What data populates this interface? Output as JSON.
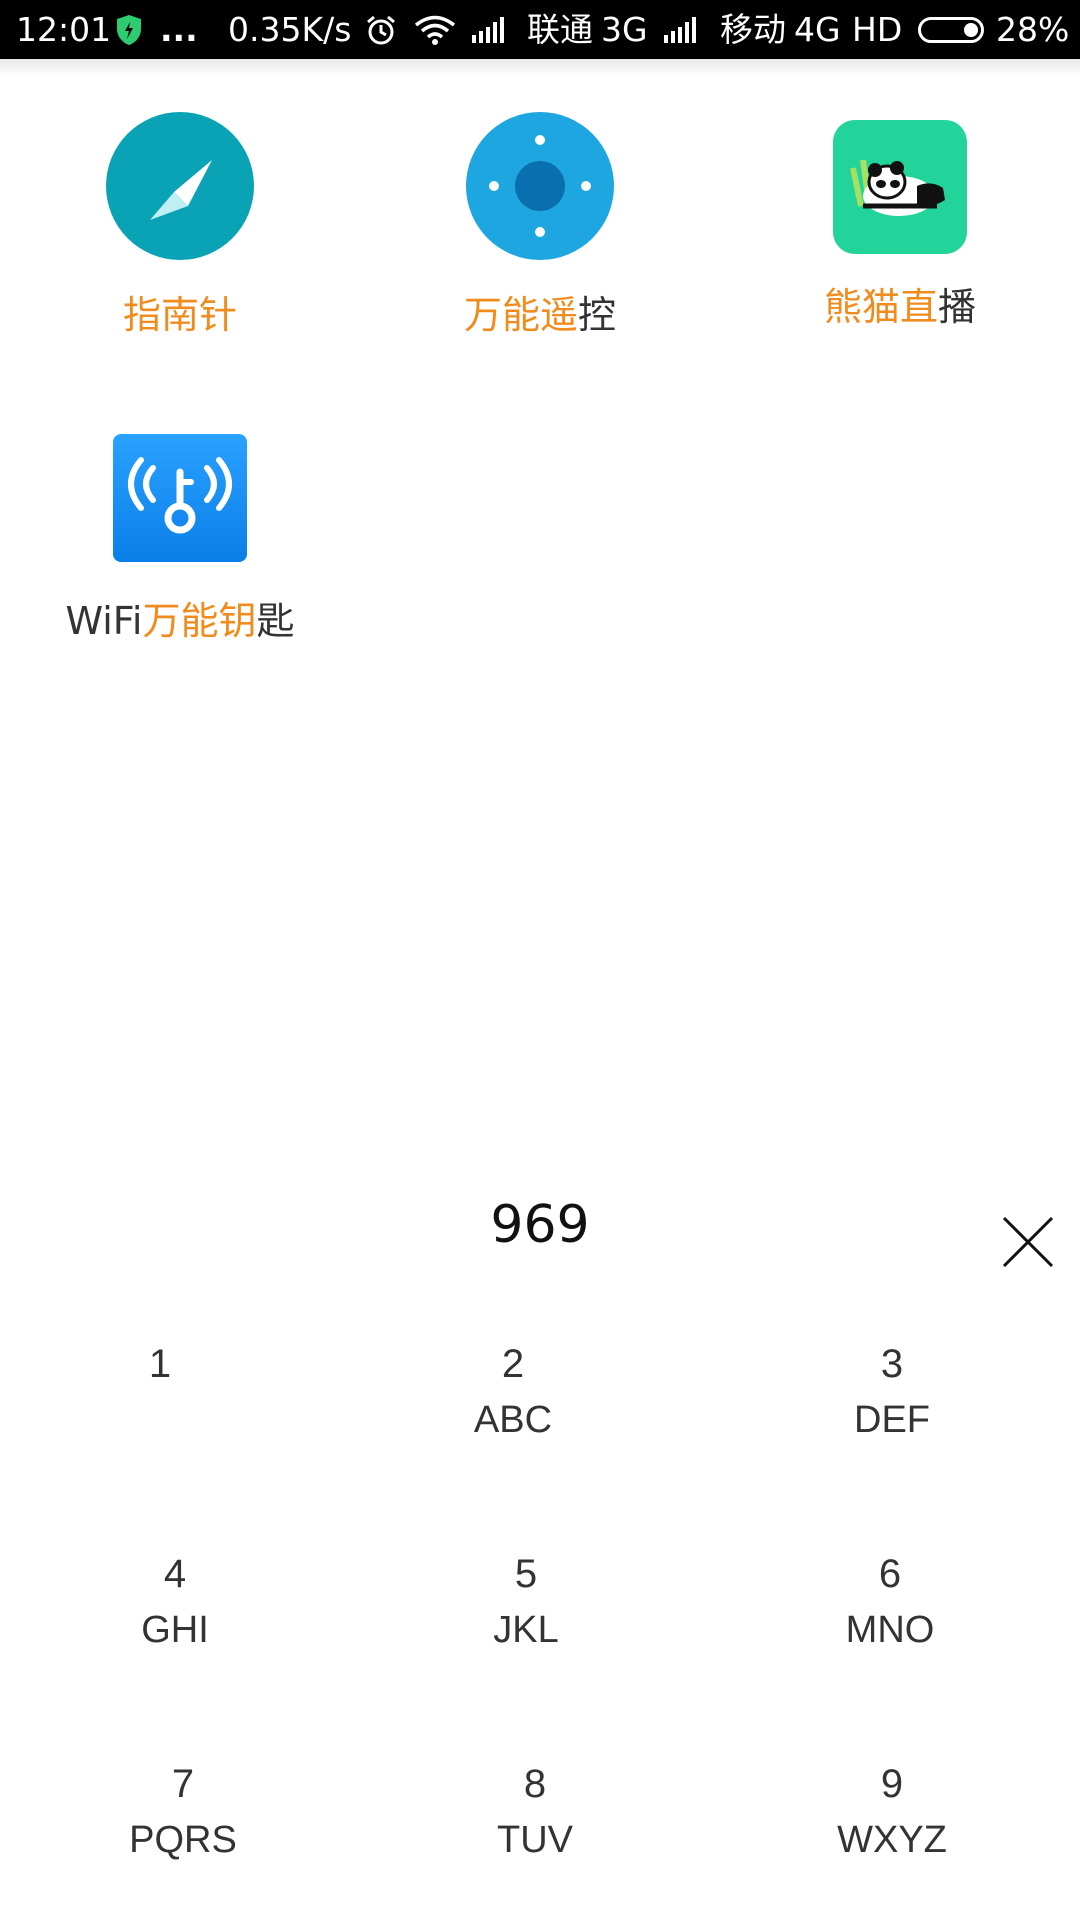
{
  "status_bar": {
    "time": "12:01",
    "more": "...",
    "net_speed": "0.35K/s",
    "carrier1": "联通",
    "carrier1_net": "3G",
    "carrier2": "移动",
    "carrier2_net": "4G",
    "hd": "HD",
    "battery": "28%",
    "battery_level": 0.28,
    "shield_color": "#2ecc71"
  },
  "apps": [
    {
      "icon": "compass-icon",
      "label_hl": "指南针",
      "label_rest": "",
      "color": "#0aa3b5"
    },
    {
      "icon": "remote-icon",
      "label_hl": "万能遥",
      "label_rest": "控",
      "color": "#1ea6e0"
    },
    {
      "icon": "panda-icon",
      "label_hl": "熊猫直",
      "label_rest": "播",
      "color": "#22d49a"
    },
    {
      "icon": "wifi-key-icon",
      "label_prefix": "WiFi",
      "label_hl": "万能钥",
      "label_rest": "匙",
      "color": "#1a8cf0"
    }
  ],
  "search": {
    "query": "969"
  },
  "keypad": [
    {
      "num": "1",
      "letters": ""
    },
    {
      "num": "2",
      "letters": "ABC"
    },
    {
      "num": "3",
      "letters": "DEF"
    },
    {
      "num": "4",
      "letters": "GHI"
    },
    {
      "num": "5",
      "letters": "JKL"
    },
    {
      "num": "6",
      "letters": "MNO"
    },
    {
      "num": "7",
      "letters": "PQRS"
    },
    {
      "num": "8",
      "letters": "TUV"
    },
    {
      "num": "9",
      "letters": "WXYZ"
    }
  ],
  "colors": {
    "highlight": "#f08c1e",
    "text": "#333333"
  }
}
